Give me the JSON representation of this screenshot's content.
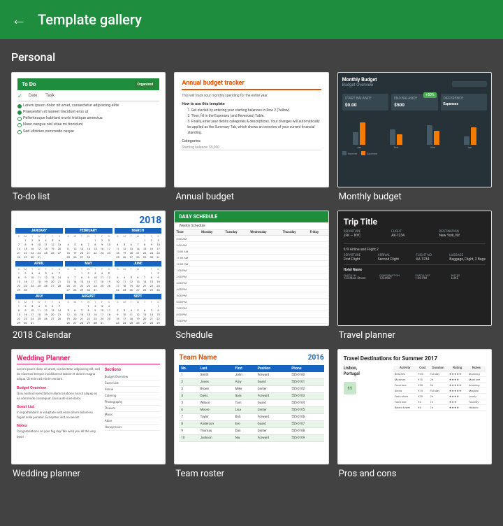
{
  "header": {
    "back_label": "←",
    "title": "Template gallery"
  },
  "section": {
    "personal_label": "Personal"
  },
  "templates": [
    {
      "id": "todo",
      "label": "To-do list",
      "type": "todo"
    },
    {
      "id": "annual-budget",
      "label": "Annual budget",
      "type": "annual"
    },
    {
      "id": "monthly-budget",
      "label": "Monthly budget",
      "type": "monthly"
    },
    {
      "id": "calendar",
      "label": "2018 Calendar",
      "type": "calendar"
    },
    {
      "id": "schedule",
      "label": "Schedule",
      "type": "schedule"
    },
    {
      "id": "travel",
      "label": "Travel planner",
      "type": "travel"
    },
    {
      "id": "wedding",
      "label": "Wedding planner",
      "type": "wedding"
    },
    {
      "id": "roster",
      "label": "Team roster",
      "type": "roster"
    },
    {
      "id": "pros",
      "label": "Pros and cons",
      "type": "pros"
    }
  ],
  "colors": {
    "header_green": "#1e8e3e",
    "bg_dark": "#424242",
    "white": "#ffffff"
  }
}
